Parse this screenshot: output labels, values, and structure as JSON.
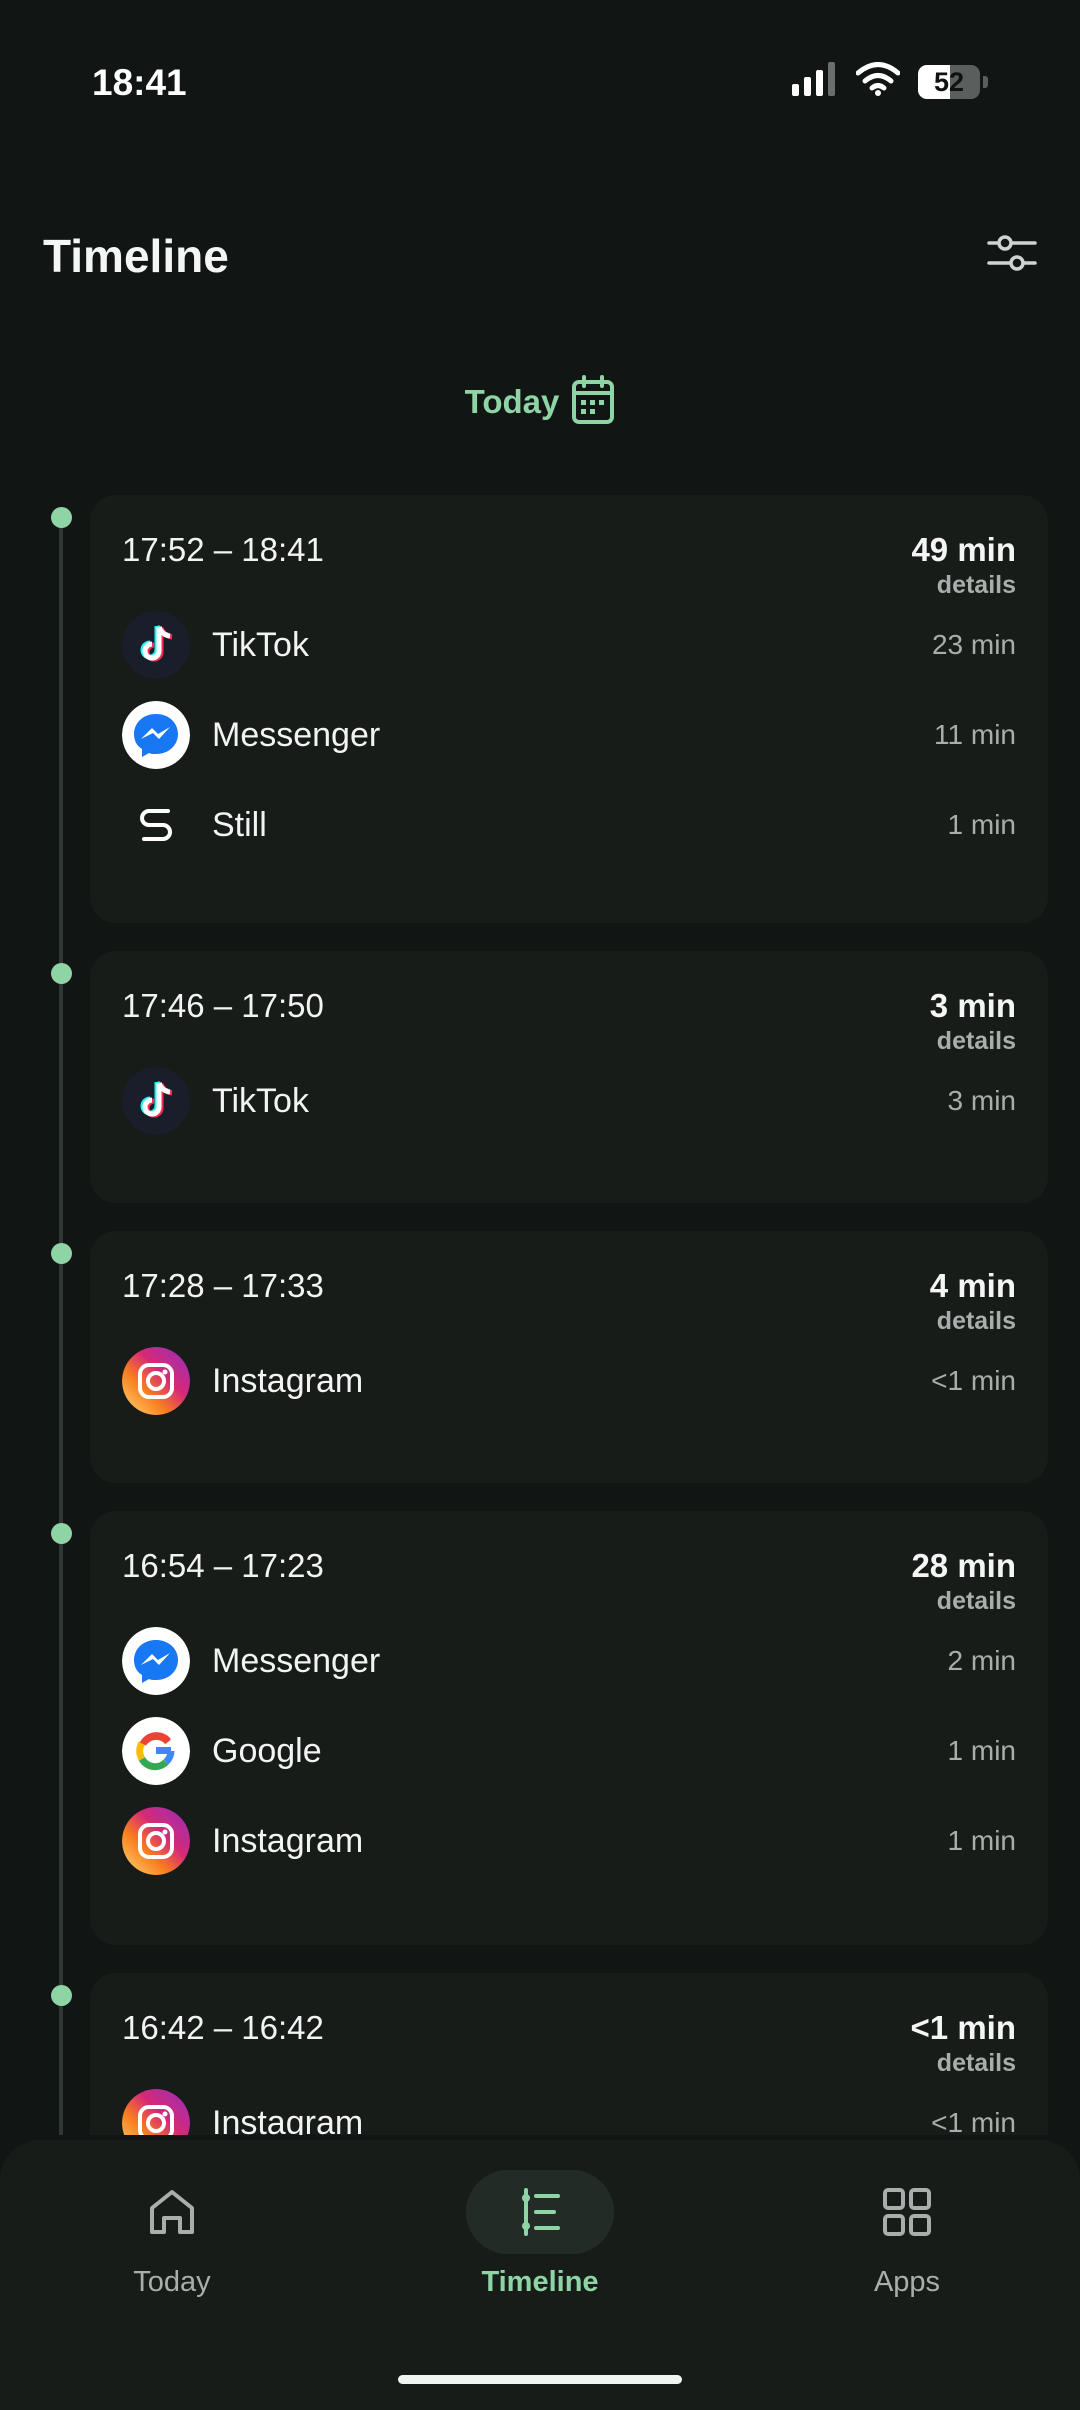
{
  "status": {
    "time": "18:41",
    "battery": "52",
    "battery_level": 0.52
  },
  "header": {
    "title": "Timeline"
  },
  "date_selector": {
    "label": "Today"
  },
  "sessions": [
    {
      "range": "17:52 – 18:41",
      "total": "49 min",
      "details": "details",
      "apps": [
        {
          "name": "TikTok",
          "dur": "23 min",
          "icon": "tiktok-icon"
        },
        {
          "name": "Messenger",
          "dur": "11 min",
          "icon": "messenger-icon"
        },
        {
          "name": "Still",
          "dur": "1 min",
          "icon": "still-icon"
        }
      ]
    },
    {
      "range": "17:46 – 17:50",
      "total": "3 min",
      "details": "details",
      "apps": [
        {
          "name": "TikTok",
          "dur": "3 min",
          "icon": "tiktok-icon"
        }
      ]
    },
    {
      "range": "17:28 – 17:33",
      "total": "4 min",
      "details": "details",
      "apps": [
        {
          "name": "Instagram",
          "dur": "<1 min",
          "icon": "instagram-icon"
        }
      ]
    },
    {
      "range": "16:54 – 17:23",
      "total": "28 min",
      "details": "details",
      "apps": [
        {
          "name": "Messenger",
          "dur": "2 min",
          "icon": "messenger-icon"
        },
        {
          "name": "Google",
          "dur": "1 min",
          "icon": "google-icon"
        },
        {
          "name": "Instagram",
          "dur": "1 min",
          "icon": "instagram-icon"
        }
      ]
    },
    {
      "range": "16:42 – 16:42",
      "total": "<1 min",
      "details": "details",
      "apps": [
        {
          "name": "Instagram",
          "dur": "<1 min",
          "icon": "instagram-icon"
        }
      ]
    }
  ],
  "nav": {
    "items": [
      {
        "label": "Today",
        "icon": "home-icon",
        "active": false
      },
      {
        "label": "Timeline",
        "icon": "timeline-icon",
        "active": true
      },
      {
        "label": "Apps",
        "icon": "grid-icon",
        "active": false
      }
    ]
  },
  "colors": {
    "accent": "#8fd4a4",
    "background": "#111513",
    "card": "#171c19"
  }
}
